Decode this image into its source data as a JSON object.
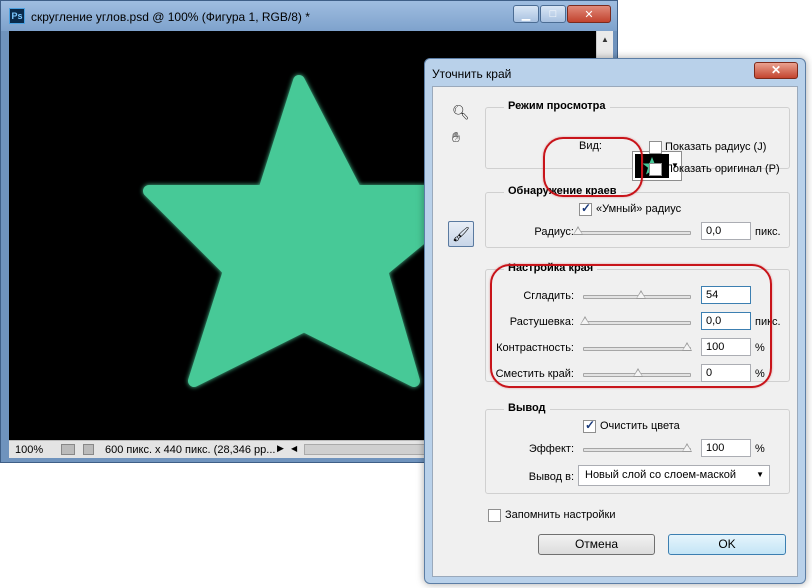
{
  "document": {
    "title": "скругление углов.psd @ 100% (Фигура 1, RGB/8) *",
    "app_icon": "Ps",
    "zoom": "100%",
    "info": "600 пикс. x 440 пикс. (28,346 pp...",
    "star_color": "#47c997",
    "canvas_color": "#000000"
  },
  "dialog": {
    "title": "Уточнить край",
    "close_label": "✕",
    "view_mode": {
      "label": "Режим просмотра",
      "view_label": "Вид:",
      "show_radius": "Показать радиус (J)",
      "show_original": "Показать оригинал (P)"
    },
    "edge_detection": {
      "label": "Обнаружение краев",
      "smart_radius": "«Умный» радиус",
      "radius_label": "Радиус:",
      "radius_value": "0,0",
      "radius_unit": "пикс."
    },
    "adjust_edge": {
      "label": "Настройка края",
      "smooth_label": "Сгладить:",
      "smooth_value": "54",
      "feather_label": "Растушевка:",
      "feather_value": "0,0",
      "feather_unit": "пикс.",
      "contrast_label": "Контрастность:",
      "contrast_value": "100",
      "contrast_unit": "%",
      "shift_label": "Сместить край:",
      "shift_value": "0",
      "shift_unit": "%"
    },
    "output": {
      "label": "Вывод",
      "decontaminate": "Очистить цвета",
      "amount_label": "Эффект:",
      "amount_value": "100",
      "amount_unit": "%",
      "output_to_label": "Вывод в:",
      "output_to_value": "Новый слой со слоем-маской"
    },
    "remember": "Запомнить настройки",
    "cancel": "Отмена",
    "ok": "OK"
  }
}
